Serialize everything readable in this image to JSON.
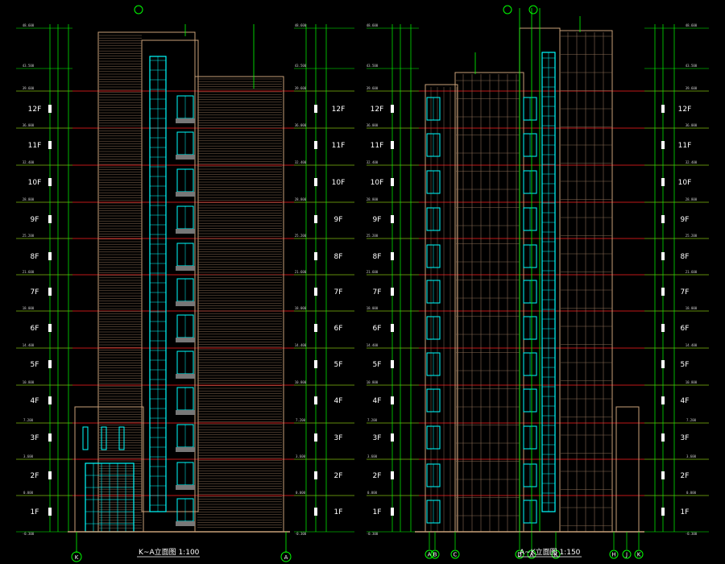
{
  "floors": [
    "1F",
    "2F",
    "3F",
    "4F",
    "5F",
    "6F",
    "7F",
    "8F",
    "9F",
    "10F",
    "11F",
    "12F"
  ],
  "elevations": [
    "-0.300",
    "0.000",
    "3.600",
    "7.200",
    "10.800",
    "14.400",
    "18.000",
    "21.600",
    "25.200",
    "28.800",
    "32.400",
    "36.000",
    "39.600",
    "43.500",
    "48.600"
  ],
  "left_caption": "K~A立面图 1:100",
  "right_caption": "A~K立面图 1:150",
  "left_axes": [
    "K",
    "A"
  ],
  "right_axes": [
    "A",
    "B",
    "C",
    "D",
    "A",
    "K",
    "H",
    "J",
    "K"
  ],
  "colors": {
    "background": "#000000",
    "grid": "#00ff00",
    "level": "#ff2020",
    "glass": "#00ffff",
    "facade": "#c8a078",
    "text": "#ffffff"
  }
}
